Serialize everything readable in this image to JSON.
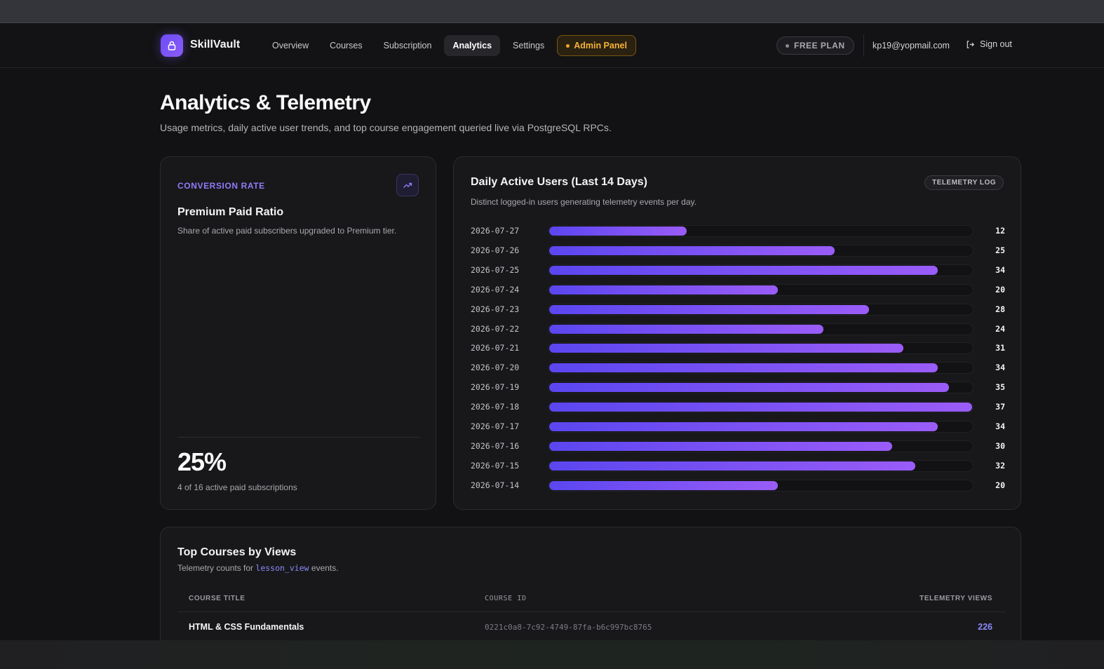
{
  "app": {
    "name": "SkillVault"
  },
  "nav": {
    "links": [
      "Overview",
      "Courses",
      "Subscription",
      "Analytics",
      "Settings"
    ],
    "active": "Analytics",
    "admin": "Admin Panel"
  },
  "account": {
    "plan": "FREE PLAN",
    "email": "kp19@yopmail.com",
    "signout": "Sign out"
  },
  "page": {
    "title": "Analytics & Telemetry",
    "subtitle": "Usage metrics, daily active user trends, and top course engagement queried live via PostgreSQL RPCs."
  },
  "conversion": {
    "eyebrow": "CONVERSION RATE",
    "title": "Premium Paid Ratio",
    "description": "Share of active paid subscribers upgraded to Premium tier.",
    "value": "25%",
    "detail": "4 of 16 active paid subscriptions"
  },
  "dau": {
    "title": "Daily Active Users (Last 14 Days)",
    "subtitle": "Distinct logged-in users generating telemetry events per day.",
    "badge": "TELEMETRY LOG"
  },
  "chart_data": {
    "type": "bar",
    "orientation": "horizontal",
    "title": "Daily Active Users (Last 14 Days)",
    "categories": [
      "2026-07-27",
      "2026-07-26",
      "2026-07-25",
      "2026-07-24",
      "2026-07-23",
      "2026-07-22",
      "2026-07-21",
      "2026-07-20",
      "2026-07-19",
      "2026-07-18",
      "2026-07-17",
      "2026-07-16",
      "2026-07-15",
      "2026-07-14"
    ],
    "values": [
      12,
      25,
      34,
      20,
      28,
      24,
      31,
      34,
      35,
      37,
      34,
      30,
      32,
      20
    ],
    "xlim": [
      0,
      37
    ],
    "colors": [
      "#5b46f0",
      "#9a5cf8"
    ]
  },
  "top_courses": {
    "title": "Top Courses by Views",
    "sub_prefix": "Telemetry counts for",
    "sub_code": "lesson_view",
    "sub_suffix": "events.",
    "columns": [
      "COURSE TITLE",
      "COURSE ID",
      "TELEMETRY VIEWS"
    ],
    "rows": [
      {
        "title": "HTML & CSS Fundamentals",
        "id": "0221c0a8-7c92-4749-87fa-b6c997bc8765",
        "views": "226"
      }
    ]
  }
}
